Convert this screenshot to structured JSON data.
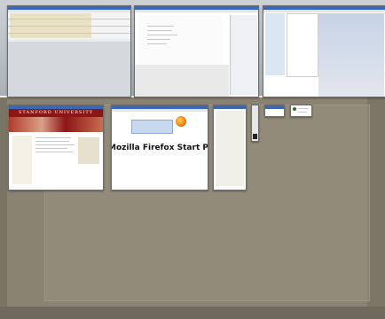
{
  "window_switcher": {
    "windows": [
      {
        "id": "1",
        "label": "spreadsheet-window"
      },
      {
        "id": "2",
        "label": "text-editor-window"
      },
      {
        "id": "3",
        "label": "file-browser-window"
      },
      {
        "id": "4",
        "title_text": "STANFORD UNIVERSITY"
      },
      {
        "id": "5",
        "title_text": "Mozilla Firefox Start Page - Mozilla Firefox"
      },
      {
        "id": "6",
        "label": "narrow-window"
      },
      {
        "id": "7",
        "label": "tiny-window"
      },
      {
        "id": "8",
        "label": "small-window"
      },
      {
        "id": "9",
        "label": "small-window-2"
      }
    ]
  },
  "colors": {
    "desktop": "#8a8372",
    "strip": "#b9bec5",
    "titlebar": "#3a67b6",
    "stanford_red": "#8c1515"
  }
}
